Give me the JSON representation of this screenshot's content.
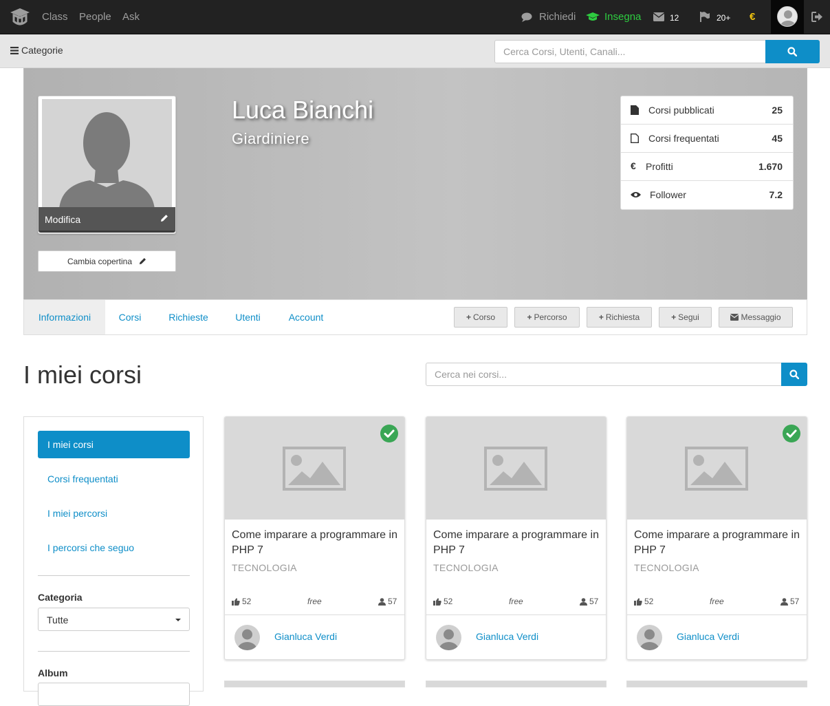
{
  "colors": {
    "accent": "#0e8ec8",
    "navbar": "#222222",
    "insegna": "#2ecc40",
    "euro": "#f1c40f",
    "check": "#3aa655"
  },
  "topnav": {
    "logo_icon": "graduation-cap-logo",
    "links": [
      "Class",
      "People",
      "Ask"
    ],
    "richiedi": "Richiedi",
    "insegna": "Insegna",
    "messages_count": "12",
    "flags_count": "20+",
    "euro_symbol": "€"
  },
  "subbar": {
    "categories_label": "Categorie",
    "search_placeholder": "Cerca Corsi, Utenti, Canali..."
  },
  "profile": {
    "name": "Luca Bianchi",
    "job": "Giardiniere",
    "edit_label": "Modifica",
    "cover_button": "Cambia copertina",
    "stats": [
      {
        "icon": "file-icon",
        "label": "Corsi pubblicati",
        "value": "25"
      },
      {
        "icon": "file-outline-icon",
        "label": "Corsi frequentati",
        "value": "45"
      },
      {
        "icon": "euro-icon",
        "label": "Profitti",
        "value": "1.670"
      },
      {
        "icon": "eye-icon",
        "label": "Follower",
        "value": "7.2"
      }
    ]
  },
  "tabs": {
    "items": [
      "Informazioni",
      "Corsi",
      "Richieste",
      "Utenti",
      "Account"
    ],
    "active": "Informazioni",
    "actions": [
      "Corso",
      "Percorso",
      "Richiesta",
      "Segui",
      "Messaggio"
    ]
  },
  "section": {
    "title": "I miei corsi",
    "search_placeholder": "Cerca nei corsi..."
  },
  "sidebar": {
    "items": [
      "I miei corsi",
      "Corsi frequentati",
      "I miei percorsi",
      "I percorsi che seguo"
    ],
    "active": "I miei corsi",
    "filter_category_label": "Categoria",
    "filter_category_value": "Tutte",
    "filter_album_label": "Album"
  },
  "cards": [
    {
      "title": "Come imparare a programmare in PHP 7",
      "category": "TECNOLOGIA",
      "likes": "52",
      "price": "free",
      "students": "57",
      "author": "Gianluca Verdi",
      "verified": true
    },
    {
      "title": "Come imparare a programmare in PHP 7",
      "category": "TECNOLOGIA",
      "likes": "52",
      "price": "free",
      "students": "57",
      "author": "Gianluca Verdi",
      "verified": false
    },
    {
      "title": "Come imparare a programmare in PHP 7",
      "category": "TECNOLOGIA",
      "likes": "52",
      "price": "free",
      "students": "57",
      "author": "Gianluca Verdi",
      "verified": true
    }
  ]
}
